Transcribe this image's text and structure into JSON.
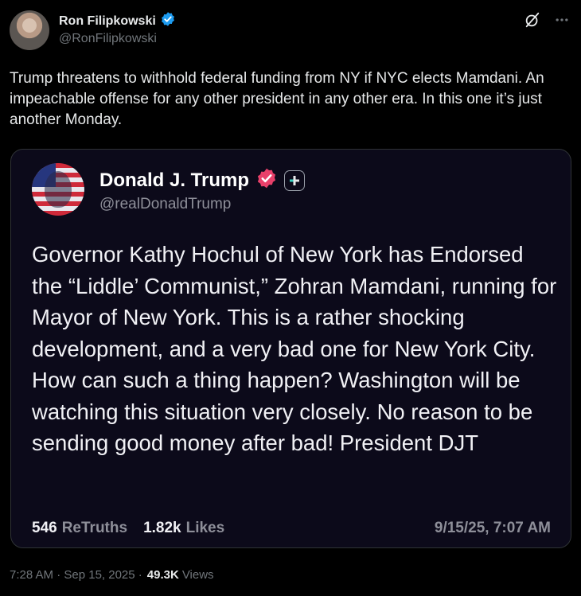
{
  "post": {
    "author_name": "Ron Filipkowski",
    "author_handle": "@RonFilipkowski",
    "text": "Trump threatens to withhold federal funding from NY if NYC elects Mamdani. An impeachable offense for any other president in any other era. In this one it’s just another Monday.",
    "more_icon": "more-horizontal-icon",
    "grok_icon": "grok-icon",
    "verified_color": "#1d9bf0"
  },
  "quote": {
    "author_name": "Donald J. Trump",
    "author_handle": "@realDonaldTrump",
    "text": "Governor Kathy Hochul of New York has Endorsed the “Liddle’ Communist,” Zohran Mamdani, running for Mayor of New York. This is a rather shocking development, and a very bad one for New York City. How can such a thing happen? Washington will be watching this situation very closely. No reason to be sending good money after bad! President DJT",
    "retruths_count": "546",
    "retruths_label": "ReTruths",
    "likes_count": "1.82k",
    "likes_label": "Likes",
    "date": "9/15/25, 7:07 AM",
    "verified_color": "#e8406a"
  },
  "meta": {
    "time_date": "7:28 AM · Sep 15, 2025 ·",
    "views_count": "49.3K",
    "views_label": "Views"
  }
}
